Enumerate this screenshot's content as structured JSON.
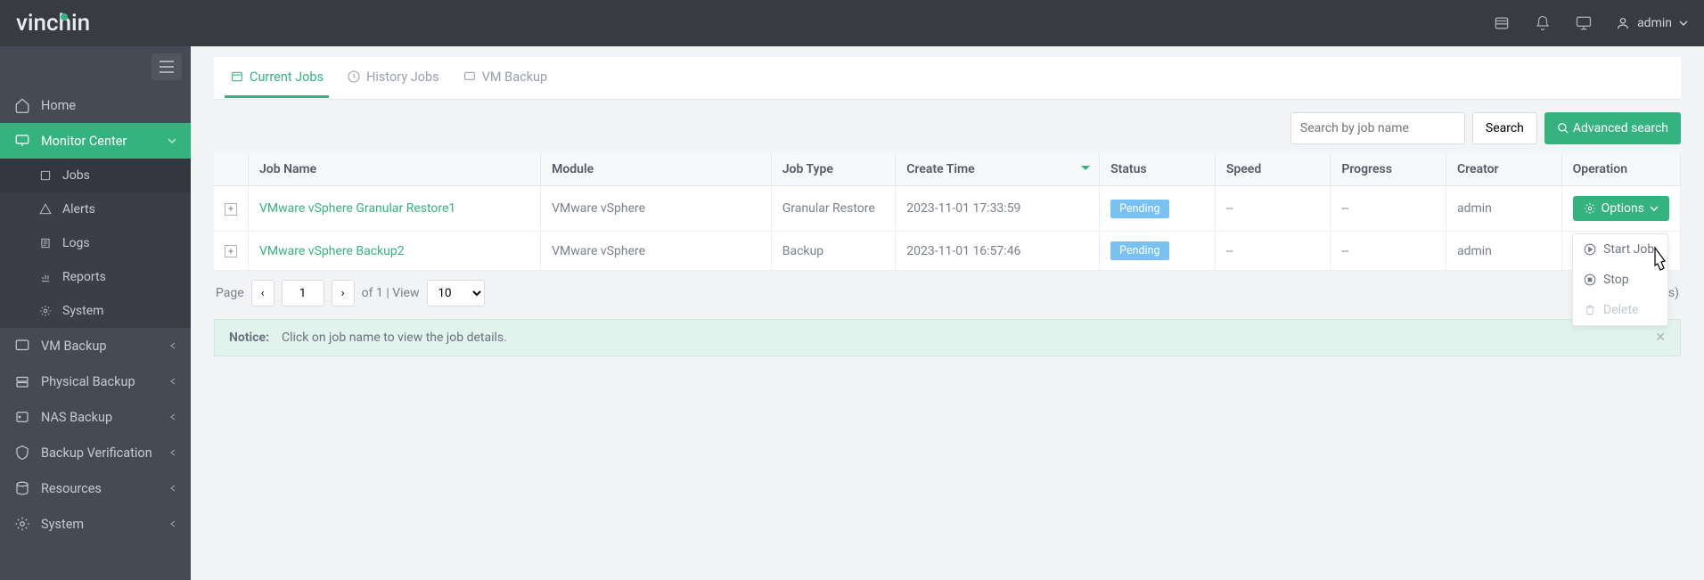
{
  "brand": "vinchin",
  "user": {
    "name": "admin"
  },
  "sidebar": {
    "home": "Home",
    "monitor": "Monitor Center",
    "sub": [
      {
        "label": "Jobs"
      },
      {
        "label": "Alerts"
      },
      {
        "label": "Logs"
      },
      {
        "label": "Reports"
      },
      {
        "label": "System"
      }
    ],
    "items": [
      {
        "label": "VM Backup"
      },
      {
        "label": "Physical Backup"
      },
      {
        "label": "NAS Backup"
      },
      {
        "label": "Backup Verification"
      },
      {
        "label": "Resources"
      },
      {
        "label": "System"
      }
    ]
  },
  "tabs": [
    {
      "label": "Current Jobs"
    },
    {
      "label": "History Jobs"
    },
    {
      "label": "VM Backup"
    }
  ],
  "search": {
    "placeholder": "Search by job name",
    "btn": "Search",
    "advanced": "Advanced search"
  },
  "columns": {
    "name": "Job Name",
    "module": "Module",
    "type": "Job Type",
    "create": "Create Time",
    "status": "Status",
    "speed": "Speed",
    "progress": "Progress",
    "creator": "Creator",
    "op": "Operation"
  },
  "rows": [
    {
      "name": "VMware vSphere Granular Restore1",
      "module": "VMware vSphere",
      "type": "Granular Restore",
      "create": "2023-11-01 17:33:59",
      "status": "Pending",
      "speed": "--",
      "progress": "--",
      "creator": "admin"
    },
    {
      "name": "VMware vSphere Backup2",
      "module": "VMware vSphere",
      "type": "Backup",
      "create": "2023-11-01 16:57:46",
      "status": "Pending",
      "speed": "--",
      "progress": "--",
      "creator": "admin"
    }
  ],
  "options_label": "Options",
  "pager": {
    "page_label": "Page",
    "page": "1",
    "of": "of 1 | View",
    "size": "10",
    "records": "record(s)"
  },
  "notice": {
    "label": "Notice:",
    "text": "Click on job name to view the job details."
  },
  "dropdown": {
    "start": "Start Job",
    "stop": "Stop",
    "delete": "Delete"
  }
}
